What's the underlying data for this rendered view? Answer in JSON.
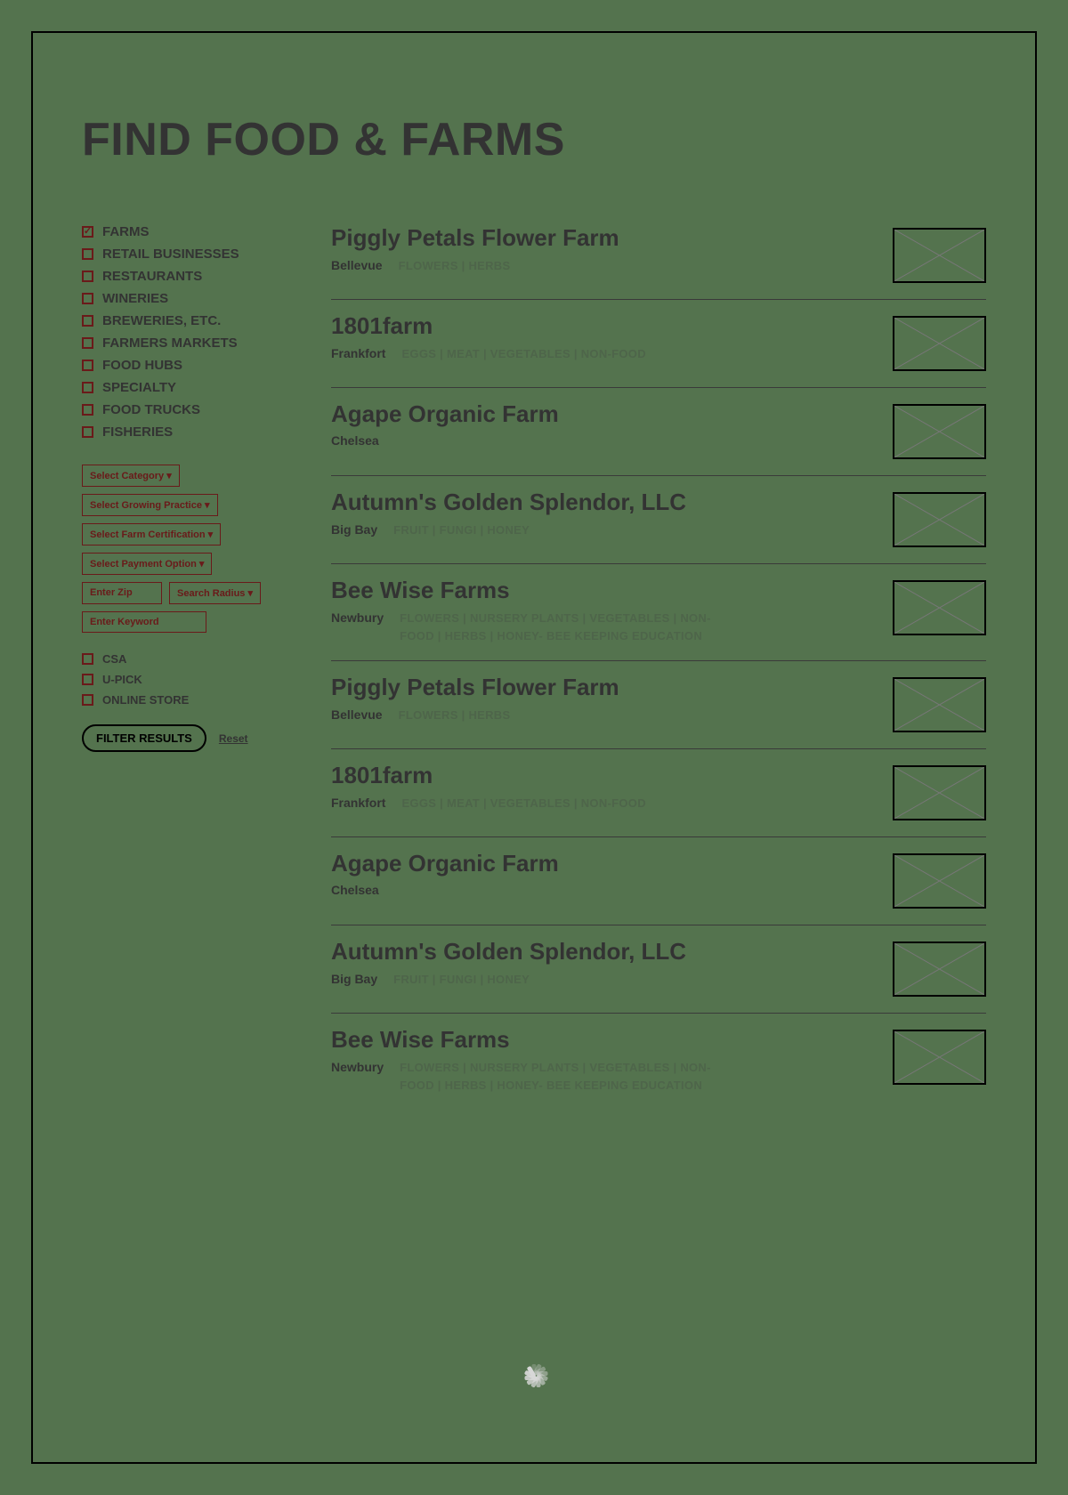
{
  "title": "FIND FOOD & FARMS",
  "categories": [
    {
      "label": "FARMS",
      "checked": true
    },
    {
      "label": "RETAIL BUSINESSES",
      "checked": false
    },
    {
      "label": "RESTAURANTS",
      "checked": false
    },
    {
      "label": "WINERIES",
      "checked": false
    },
    {
      "label": "BREWERIES, ETC.",
      "checked": false
    },
    {
      "label": "FARMERS MARKETS",
      "checked": false
    },
    {
      "label": "FOOD HUBS",
      "checked": false
    },
    {
      "label": "SPECIALTY",
      "checked": false
    },
    {
      "label": "FOOD TRUCKS",
      "checked": false
    },
    {
      "label": "FISHERIES",
      "checked": false
    }
  ],
  "filters": {
    "category_select": "Select Category ▾",
    "growing_select": "Select Growing Practice ▾",
    "cert_select": "Select Farm Certification ▾",
    "payment_select": "Select Payment Option ▾",
    "zip_placeholder": "Enter Zip",
    "radius_select": "Search Radius ▾",
    "keyword_placeholder": "Enter Keyword"
  },
  "toggles": [
    {
      "label": "CSA",
      "checked": false
    },
    {
      "label": "U-PICK",
      "checked": false
    },
    {
      "label": "ONLINE STORE",
      "checked": false
    }
  ],
  "buttons": {
    "filter": "FILTER RESULTS",
    "reset": "Reset"
  },
  "results": [
    {
      "title": "Piggly Petals Flower Farm",
      "location": "Bellevue",
      "tags": "FLOWERS | HERBS"
    },
    {
      "title": "1801farm",
      "location": "Frankfort",
      "tags": "EGGS | MEAT | VEGETABLES | NON-FOOD"
    },
    {
      "title": "Agape Organic Farm",
      "location": "Chelsea",
      "tags": ""
    },
    {
      "title": "Autumn's Golden Splendor, LLC",
      "location": "Big Bay",
      "tags": "FRUIT | FUNGI | HONEY"
    },
    {
      "title": "Bee Wise Farms",
      "location": "Newbury",
      "tags": "FLOWERS | NURSERY PLANTS | VEGETABLES | NON-FOOD | HERBS | HONEY- BEE KEEPING EDUCATION"
    },
    {
      "title": "Piggly Petals Flower Farm",
      "location": "Bellevue",
      "tags": "FLOWERS | HERBS"
    },
    {
      "title": "1801farm",
      "location": "Frankfort",
      "tags": "EGGS | MEAT | VEGETABLES | NON-FOOD"
    },
    {
      "title": "Agape Organic Farm",
      "location": "Chelsea",
      "tags": ""
    },
    {
      "title": "Autumn's Golden Splendor, LLC",
      "location": "Big Bay",
      "tags": "FRUIT | FUNGI | HONEY"
    },
    {
      "title": "Bee Wise Farms",
      "location": "Newbury",
      "tags": "FLOWERS | NURSERY PLANTS | VEGETABLES | NON-FOOD | HERBS | HONEY- BEE KEEPING EDUCATION"
    }
  ]
}
